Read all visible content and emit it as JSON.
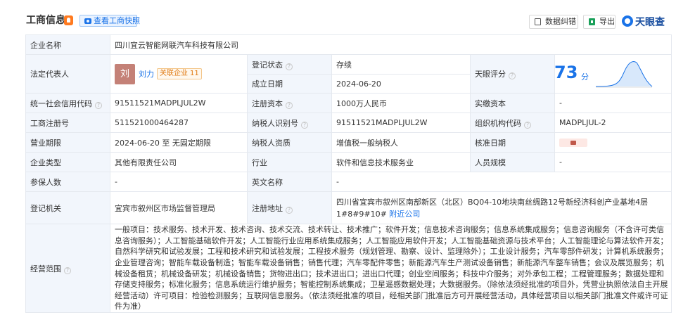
{
  "header": {
    "title": "工商信息",
    "snapshot_label": "查看工商快照",
    "correction_label": "数据纠错",
    "export_label": "导出",
    "brand_label": "天眼查"
  },
  "labels": {
    "company_name": "企业名称",
    "legal_rep": "法定代表人",
    "reg_status": "登记状态",
    "founded": "成立日期",
    "tianyan_score": "天眼评分",
    "credit_code": "统一社会信用代码",
    "reg_capital": "注册资本",
    "paid_capital": "实缴资本",
    "biz_reg_no": "工商注册号",
    "taxpayer_id": "纳税人识别号",
    "org_code": "组织机构代码",
    "biz_term": "营业期限",
    "taxpayer_qual": "纳税人资质",
    "approval_date": "核准日期",
    "company_type": "企业类型",
    "industry": "行业",
    "staff_size": "人员规模",
    "insured": "参保人数",
    "english_name": "英文名称",
    "reg_authority": "登记机关",
    "reg_address": "注册地址",
    "biz_scope": "经营范围"
  },
  "values": {
    "company_name": "四川宜云智能网联汽车科技有限公司",
    "rep_avatar": "刘",
    "rep_name": "刘力",
    "related_label": "关联企业",
    "related_count": "11",
    "reg_status": "存续",
    "founded": "2024-06-20",
    "score": "73",
    "score_unit": "分",
    "credit_code": "91511521MADPLJUL2W",
    "reg_capital": "1000万人民币",
    "paid_capital": "-",
    "biz_reg_no": "511521000464287",
    "taxpayer_id": "91511521MADPLJUL2W",
    "org_code": "MADPLJUL-2",
    "biz_term": "2024-06-20 至 无固定期限",
    "taxpayer_qual": "增值税一般纳税人",
    "company_type": "其他有限责任公司",
    "industry": "软件和信息技术服务业",
    "staff_size": "-",
    "insured": "-",
    "english_name": "-",
    "reg_authority": "宜宾市叙州区市场监督管理局",
    "reg_address": "四川省宜宾市叙州区南部新区（北区）BQ04-10地块南丝绸路12号新经济科创产业基地4层1#8#9#10#",
    "address_link": "附近公司",
    "biz_scope": "一般项目：技术服务、技术开发、技术咨询、技术交流、技术转让、技术推广；软件开发；信息技术咨询服务；信息系统集成服务；信息咨询服务（不含许可类信息咨询服务）；人工智能基础软件开发；人工智能行业应用系统集成服务；人工智能应用软件开发；人工智能基础资源与技术平台；人工智能理论与算法软件开发；自然科学研究和试验发展；工程和技术研究和试验发展；工程技术服务（规划管理、勘察、设计、监理除外）；工业设计服务；汽车零部件研发；计算机系统服务；企业管理咨询；智能车载设备制造；智能车载设备销售；销售代理；汽车零配件零售；新能源汽车生产测试设备销售；新能源汽车整车销售；会议及展览服务；机械设备租赁；机械设备研发；机械设备销售；货物进出口；技术进出口；进出口代理；创业空间服务；科技中介服务；对外承包工程；工程管理服务；数据处理和存储支持服务；标准化服务；信息系统运行维护服务；智能控制系统集成；卫星遥感数据处理；大数据服务。（除依法须经批准的项目外，凭营业执照依法自主开展经营活动）许可项目：检验检测服务；互联网信息服务。（依法须经批准的项目，经相关部门批准后方可开展经营活动，具体经营项目以相关部门批准文件或许可证件为准）"
  },
  "colors": {
    "accent": "#1a73e8",
    "status_green": "#21a366",
    "key_bg": "#f2f6fc",
    "badge_orange": "#ff7a1f"
  },
  "icons": [
    "flame-badge-icon",
    "camera-icon",
    "correction-icon",
    "excel-export-icon",
    "tianyancha-logo-icon",
    "help-icon",
    "lock-icon"
  ]
}
